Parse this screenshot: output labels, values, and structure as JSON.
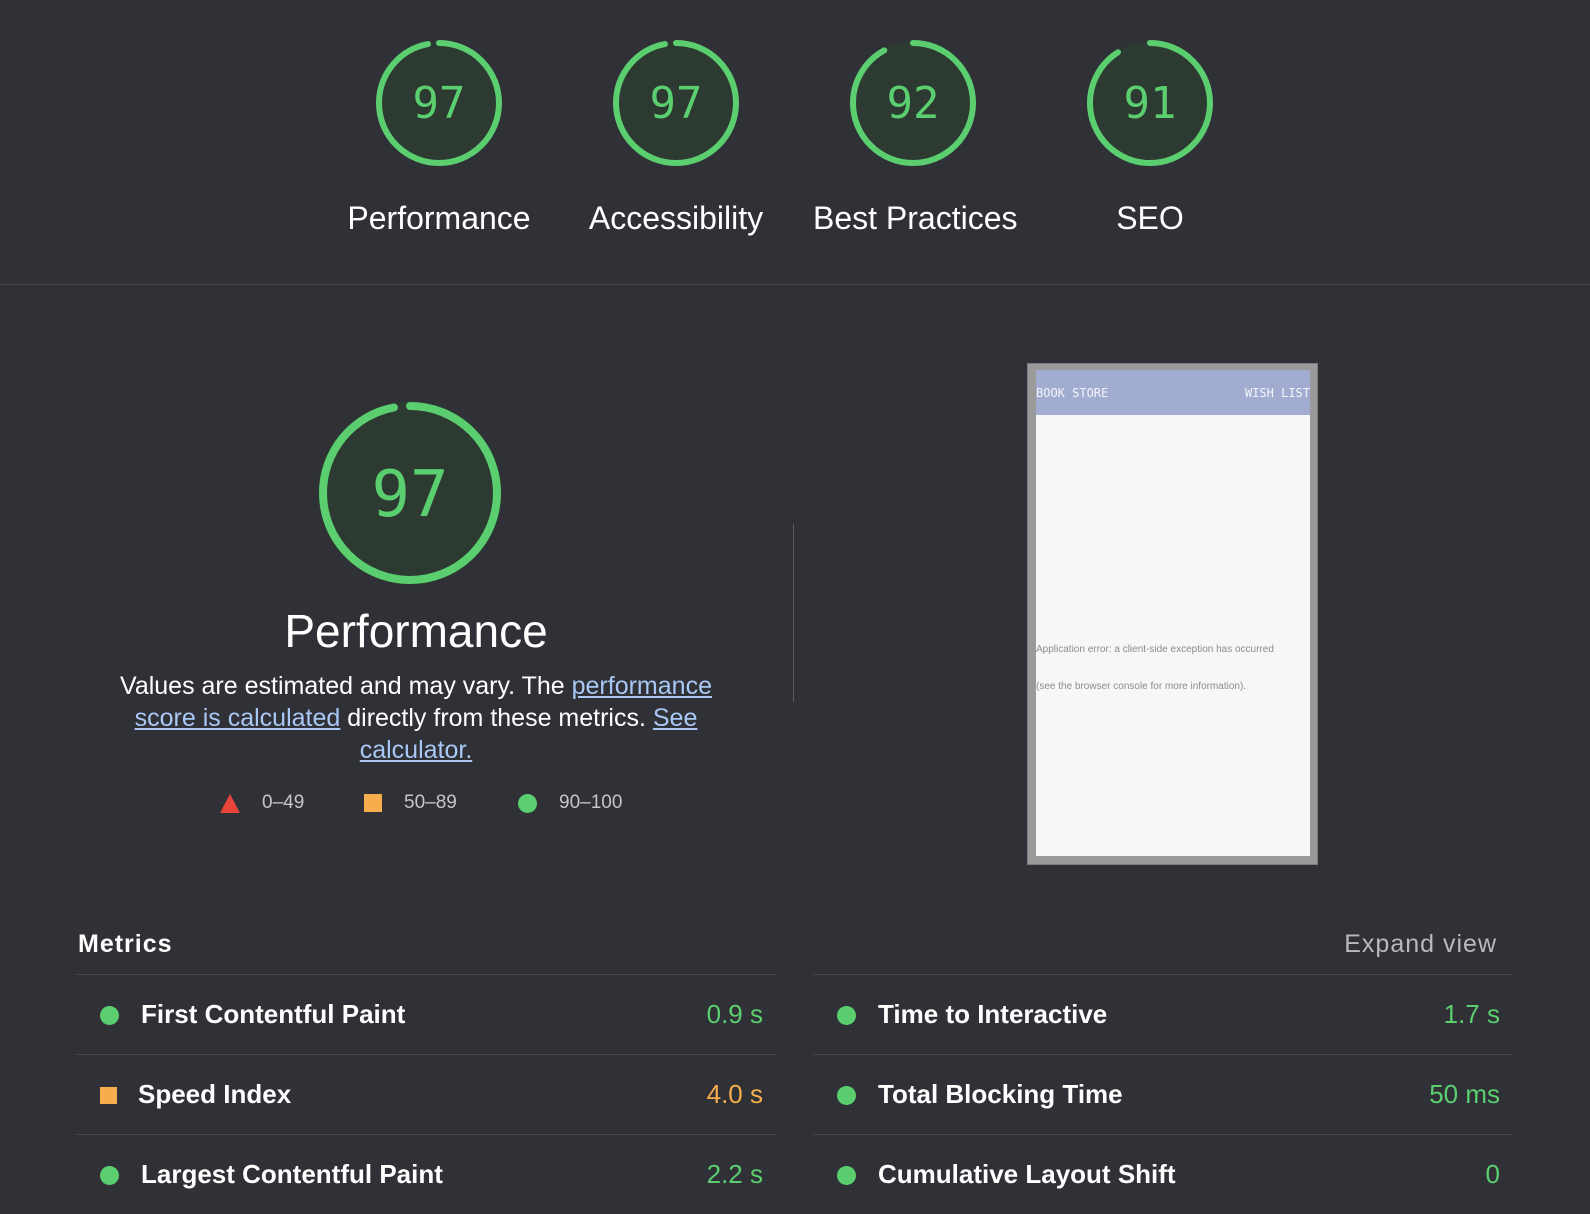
{
  "gauges": [
    {
      "score": 97,
      "label": "Performance"
    },
    {
      "score": 97,
      "label": "Accessibility"
    },
    {
      "score": 92,
      "label": "Best Practices"
    },
    {
      "score": 91,
      "label": "SEO"
    }
  ],
  "performance": {
    "score": 97,
    "title": "Performance",
    "desc_text_1": "Values are estimated and may vary. The ",
    "desc_link_1": "performance score is calculated",
    "desc_text_2": " directly from these metrics. ",
    "desc_link_2": "See calculator."
  },
  "legend": [
    {
      "range": "0–49",
      "icon": "red-triangle-icon"
    },
    {
      "range": "50–89",
      "icon": "orange-square-icon"
    },
    {
      "range": "90–100",
      "icon": "green-circle-icon"
    }
  ],
  "thumbnail": {
    "header_left": "BOOK STORE",
    "header_right": "WISH LIST",
    "error_line_1": "Application error: a client-side exception has occurred",
    "error_line_2": "(see the browser console for more information)."
  },
  "metrics": {
    "heading": "Metrics",
    "expand_label": "Expand view",
    "left": [
      {
        "name": "First Contentful Paint",
        "value": "0.9 s",
        "status": "pass"
      },
      {
        "name": "Speed Index",
        "value": "4.0 s",
        "status": "average"
      },
      {
        "name": "Largest Contentful Paint",
        "value": "2.2 s",
        "status": "pass"
      }
    ],
    "right": [
      {
        "name": "Time to Interactive",
        "value": "1.7 s",
        "status": "pass"
      },
      {
        "name": "Total Blocking Time",
        "value": "50 ms",
        "status": "pass"
      },
      {
        "name": "Cumulative Layout Shift",
        "value": "0",
        "status": "pass"
      }
    ]
  },
  "colors": {
    "pass": "#5bcf70",
    "average": "#f6ad4b",
    "fail": "#e8443a",
    "background": "#303136",
    "link": "#a9c8f5"
  }
}
